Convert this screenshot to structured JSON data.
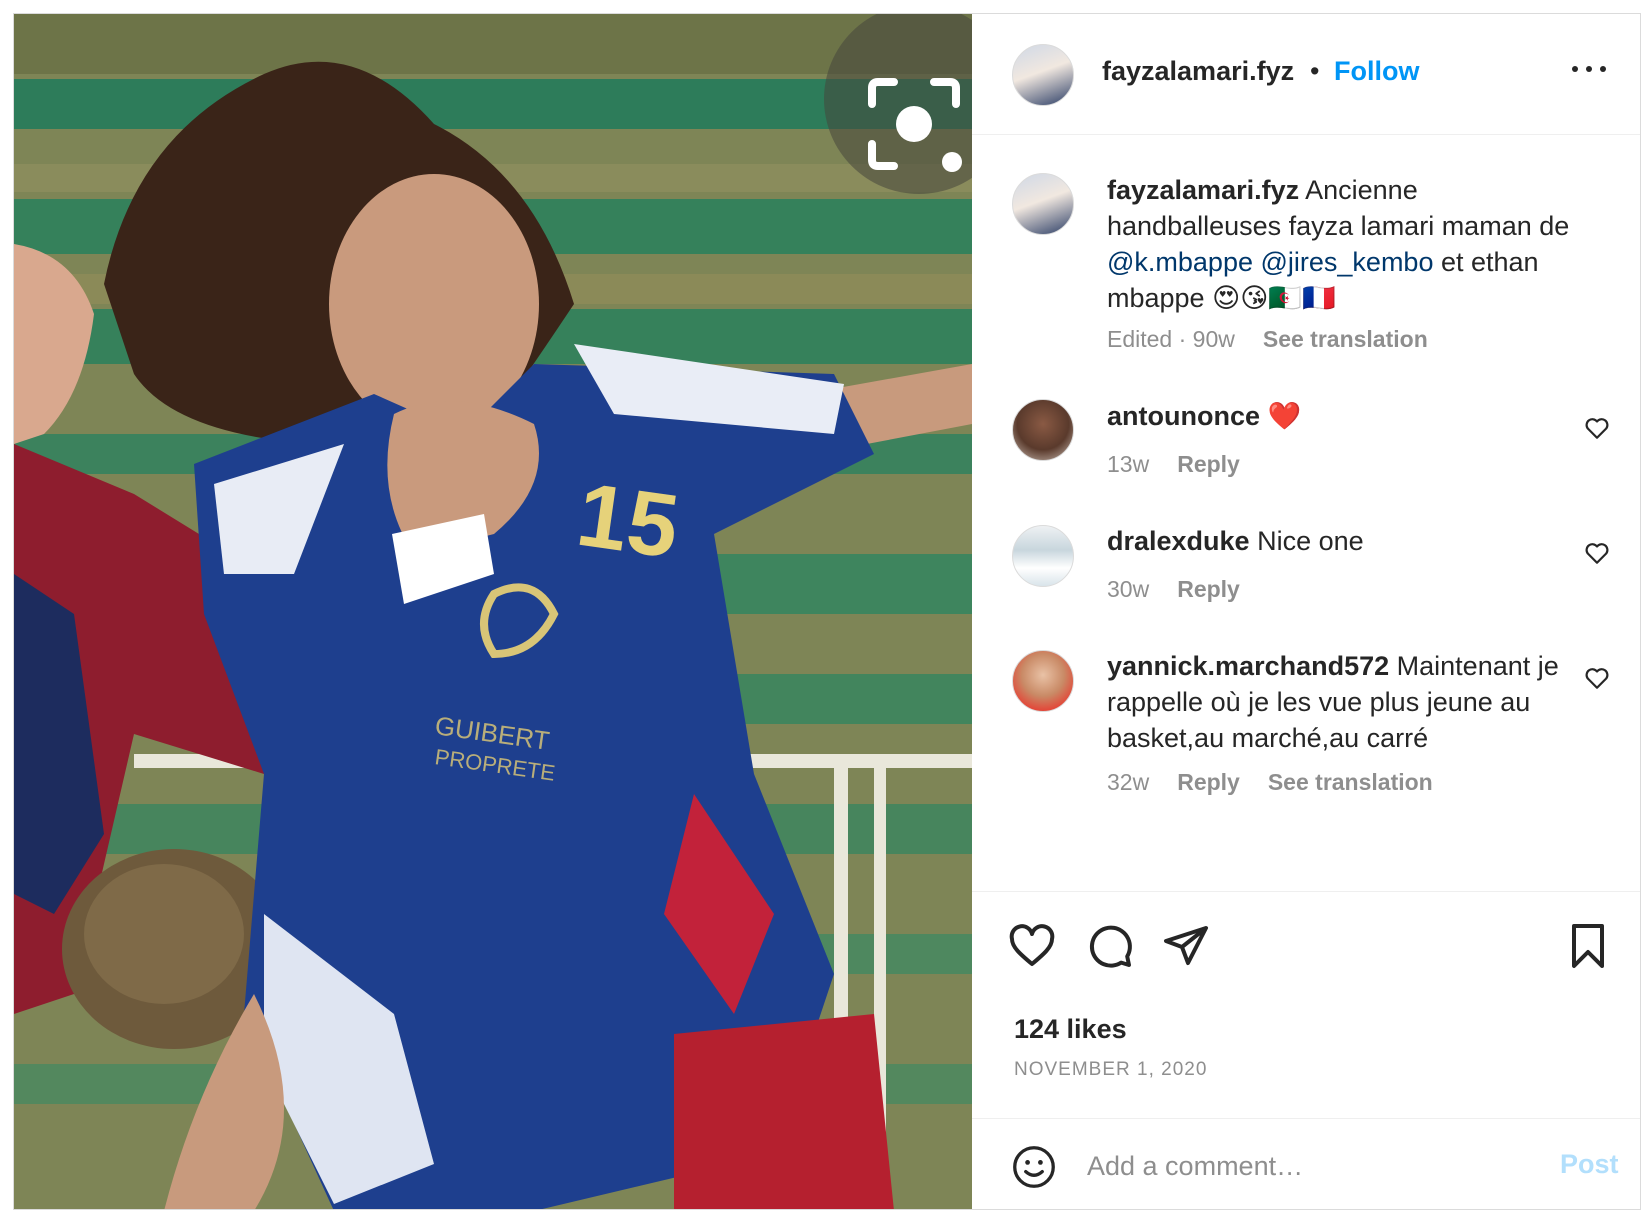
{
  "post": {
    "username": "fayzalamari.fyz",
    "separator": "•",
    "follow_label": "Follow",
    "caption": {
      "username": "fayzalamari.fyz",
      "text_before": " Ancienne handballeuses fayza lamari maman de ",
      "mention_1": "@k.mbappe",
      "mention_2": "@jires_kembo",
      "text_after": " et ethan mbappe 😍😘🇩🇿🇫🇷",
      "meta": "Edited · 90w",
      "see_translation": "See translation"
    },
    "comments": [
      {
        "username": "antounonce",
        "text": " ❤️",
        "time": "13w",
        "reply": "Reply"
      },
      {
        "username": "dralexduke",
        "text": " Nice one",
        "time": "30w",
        "reply": "Reply"
      },
      {
        "username": "yannick.marchand572",
        "text": " Maintenant je rappelle où je les vue plus jeune au basket,au marché,au carré",
        "time": "32w",
        "reply": "Reply",
        "see_translation": "See translation"
      }
    ],
    "likes": "124 likes",
    "date": "NOVEMBER 1, 2020",
    "add_comment_placeholder": "Add a comment…",
    "post_label": "Post"
  },
  "icons": {
    "more": "more-options-icon",
    "like": "heart-icon",
    "comment": "comment-bubble-icon",
    "share": "paper-plane-icon",
    "save": "bookmark-icon",
    "emoji": "smiley-icon",
    "visual_search": "visual-search-icon"
  },
  "colors": {
    "accent": "#0095f6",
    "mention": "#00376b",
    "muted": "#8e8e8e",
    "post_disabled": "#b2dffc",
    "heart_red": "#ed4956"
  }
}
